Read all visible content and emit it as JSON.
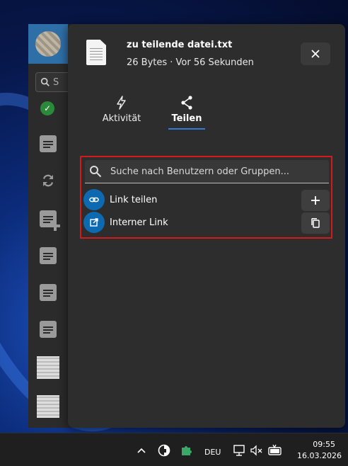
{
  "panel": {
    "file_name": "zu teilende datei.txt",
    "file_meta": "26 Bytes · Vor 56 Sekunden",
    "close_icon": "close-icon"
  },
  "tabs": [
    {
      "label": "Aktivität",
      "icon": "lightning-icon",
      "active": false
    },
    {
      "label": "Teilen",
      "icon": "share-icon",
      "active": true
    }
  ],
  "share": {
    "search_placeholder": "Suche nach Benutzern oder Gruppen...",
    "link_label": "Link teilen",
    "internal_label": "Interner Link"
  },
  "sidebar": {
    "search_partial": "S"
  },
  "taskbar": {
    "language": "DEU",
    "time": "09:55",
    "date": "16.03.2026"
  },
  "colors": {
    "accent": "#0d6ab0",
    "highlight_border": "#d11a1a",
    "tab_underline": "#2f7fd6",
    "panel_bg": "#2d2d2d"
  }
}
